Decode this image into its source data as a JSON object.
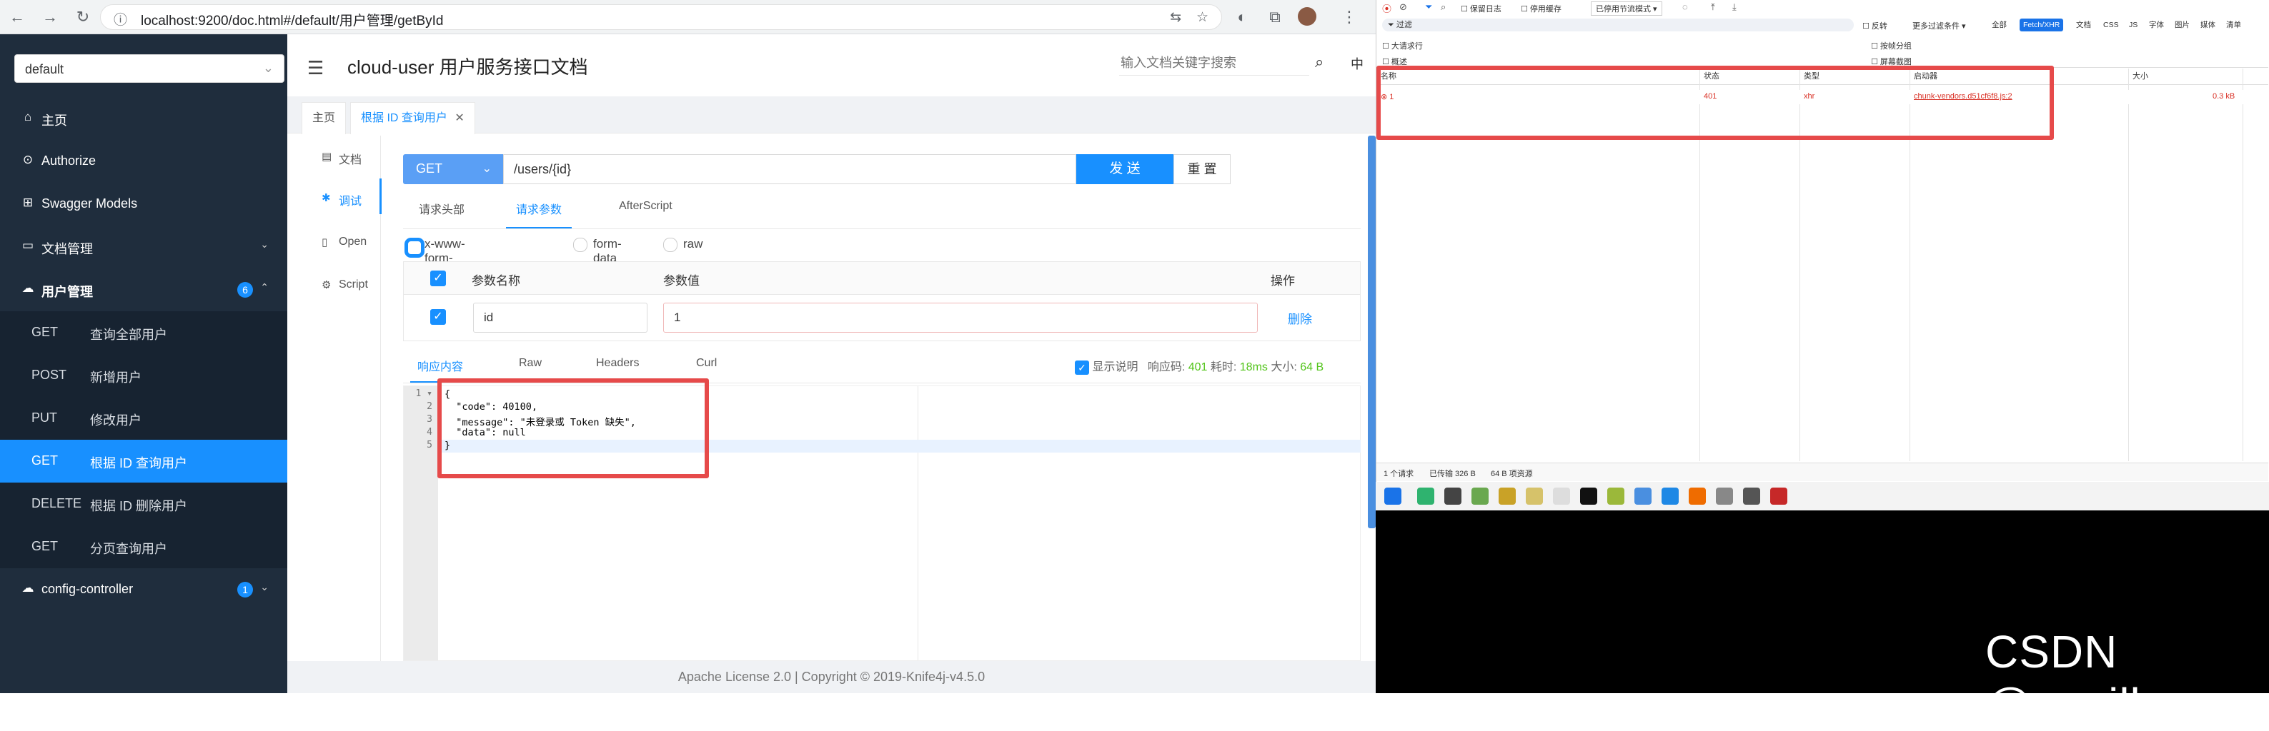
{
  "browser": {
    "url": "localhost:9200/doc.html#/default/用户管理/getById"
  },
  "sidebar": {
    "space": "default",
    "items": [
      {
        "label": "主页"
      },
      {
        "label": "Authorize"
      },
      {
        "label": "Swagger Models"
      },
      {
        "label": "文档管理"
      },
      {
        "label": "用户管理",
        "badge": "6"
      },
      {
        "label": "config-controller",
        "badge": "1"
      }
    ],
    "endpoints": [
      {
        "method": "GET",
        "label": "查询全部用户"
      },
      {
        "method": "POST",
        "label": "新增用户"
      },
      {
        "method": "PUT",
        "label": "修改用户"
      },
      {
        "method": "GET",
        "label": "根据 ID 查询用户"
      },
      {
        "method": "DELETE",
        "label": "根据 ID 删除用户"
      },
      {
        "method": "GET",
        "label": "分页查询用户"
      }
    ]
  },
  "header": {
    "title": "cloud-user 用户服务接口文档",
    "search_placeholder": "输入文档关键字搜索",
    "lang": "中"
  },
  "tabs": [
    "主页",
    "根据 ID 查询用户"
  ],
  "vtabs": [
    "文档",
    "调试",
    "Open",
    "Script"
  ],
  "request": {
    "method": "GET",
    "path": "/users/{id}",
    "send": "发 送",
    "reset": "重 置",
    "subtabs": [
      "请求头部",
      "请求参数",
      "AfterScript"
    ],
    "body_types": [
      "x-www-form-urlencoded",
      "form-data",
      "raw"
    ],
    "table_headers": [
      "参数名称",
      "参数值",
      "操作"
    ],
    "param_name": "id",
    "param_value": "1",
    "delete": "删除"
  },
  "response": {
    "tabs": [
      "响应内容",
      "Raw",
      "Headers",
      "Curl"
    ],
    "show_desc": "显示说明",
    "code_label": "响应码:",
    "code": "401",
    "time_label": "耗时:",
    "time": "18ms",
    "size_label": "大小:",
    "size": "64 B",
    "lines": [
      "{",
      "  \"code\": 40100,",
      "  \"message\": \"未登录或 Token 缺失\",",
      "  \"data\": null",
      "}"
    ]
  },
  "footer": "Apache License 2.0 | Copyright © 2019-Knife4j-v4.5.0",
  "devtools": {
    "preserve_log": "保留日志",
    "disable_cache": "停用缓存",
    "throttle": "已停用节流模式",
    "filter_placeholder": "过滤",
    "invert": "反转",
    "more_filters": "更多过滤条件",
    "type_filters": [
      "全部",
      "Fetch/XHR",
      "文档",
      "CSS",
      "JS",
      "字体",
      "图片",
      "媒体",
      "清单"
    ],
    "options": [
      "大请求行",
      "概述",
      "按帧分组",
      "屏幕截图"
    ],
    "columns": [
      "名称",
      "状态",
      "类型",
      "启动器",
      "大小"
    ],
    "row": {
      "name": "1",
      "status": "401",
      "type": "xhr",
      "initiator": "chunk-vendors.d51cf6f8.js:2",
      "size": "0.3 kB"
    },
    "status_bar": [
      "1 个请求",
      "已传输 326 B",
      "64 B 项资源"
    ]
  },
  "watermark": "CSDN @worilb",
  "colors": {
    "accent": "#1890ff",
    "sidebar": "#1f2d3d",
    "highlight": "#e64a4a"
  }
}
